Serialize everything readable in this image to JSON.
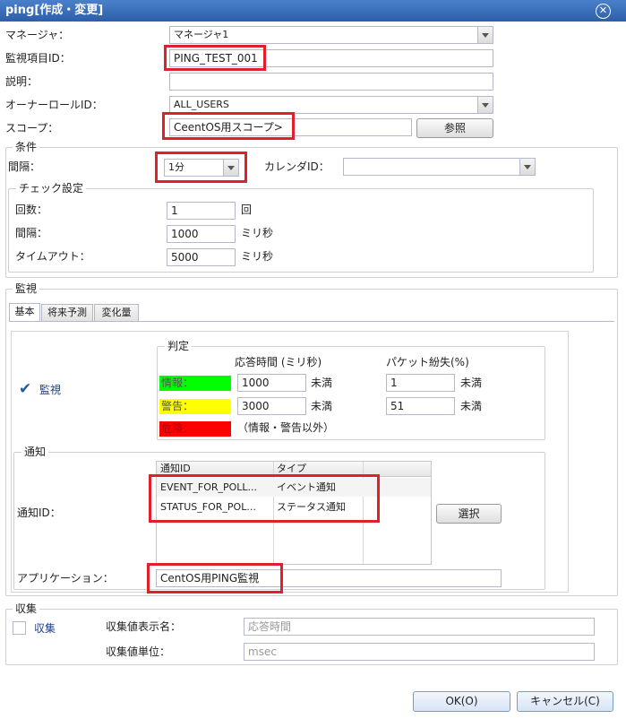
{
  "window": {
    "title": "ping[作成・変更]",
    "close_icon": "close-icon"
  },
  "form": {
    "manager_label": "マネージャ：",
    "manager_value": "マネージャ1",
    "monitor_id_label": "監視項目ID：",
    "monitor_id_value": "PING_TEST_001",
    "description_label": "説明：",
    "description_value": "",
    "owner_role_label": "オーナーロールID：",
    "owner_role_value": "ALL_USERS",
    "scope_label": "スコープ：",
    "scope_value": "CeentOS用スコープ>",
    "scope_button": "参照"
  },
  "conditions": {
    "legend": "条件",
    "interval_label": "間隔：",
    "interval_value": "1分",
    "calendar_label": "カレンダID：",
    "calendar_value": "",
    "check": {
      "legend": "チェック設定",
      "count_label": "回数：",
      "count_value": "1",
      "count_unit": "回",
      "interval_label": "間隔：",
      "interval_value": "1000",
      "interval_unit": "ミリ秒",
      "timeout_label": "タイムアウト：",
      "timeout_value": "5000",
      "timeout_unit": "ミリ秒"
    }
  },
  "monitor": {
    "legend": "監視",
    "tabs": [
      "基本",
      "将来予測",
      "変化量"
    ],
    "enable_label": "監視",
    "judgement": {
      "legend": "判定",
      "col_response": "応答時間 (ミリ秒)",
      "col_packet": "パケット紛失(%)",
      "info_label": "情報：",
      "info_response": "1000",
      "info_packet": "1",
      "warn_label": "警告：",
      "warn_response": "3000",
      "warn_packet": "51",
      "less_than": "未満",
      "critical_label": "危険：",
      "other_text": "（情報・警告以外）",
      "colors": {
        "info": "#00ff00",
        "warn": "#ffff00",
        "critical": "#ff0000"
      }
    },
    "notify": {
      "legend": "通知",
      "id_label": "通知ID：",
      "col_id": "通知ID",
      "col_type": "タイプ",
      "rows": [
        {
          "id": "EVENT_FOR_POLL...",
          "type": "イベント通知"
        },
        {
          "id": "STATUS_FOR_POL...",
          "type": "ステータス通知"
        }
      ],
      "select_button": "選択",
      "app_label": "アプリケーション：",
      "app_value": "CentOS用PING監視"
    }
  },
  "collect": {
    "legend": "収集",
    "enable_label": "収集",
    "display_name_label": "収集値表示名：",
    "display_name_value": "応答時間",
    "unit_label": "収集値単位：",
    "unit_value": "msec"
  },
  "footer": {
    "ok": "OK(O)",
    "cancel": "キャンセル(C)"
  }
}
